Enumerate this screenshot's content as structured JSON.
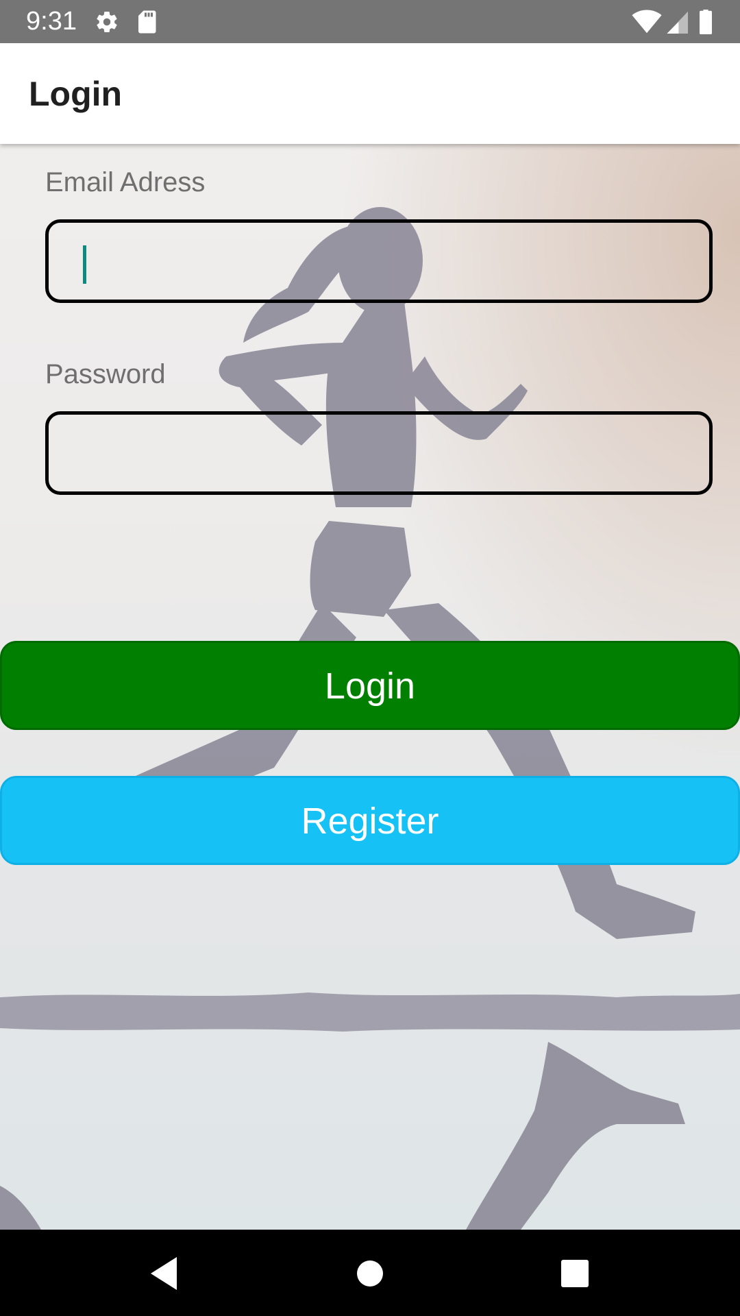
{
  "status_bar": {
    "time": "9:31",
    "left_icons": [
      "gear-icon",
      "sd-card-icon"
    ],
    "right_icons": [
      "wifi-icon",
      "signal-icon",
      "battery-icon"
    ]
  },
  "app_bar": {
    "title": "Login"
  },
  "form": {
    "email": {
      "label": "Email Adress",
      "value": ""
    },
    "password": {
      "label": "Password",
      "value": ""
    }
  },
  "buttons": {
    "login": {
      "label": "Login",
      "color": "#007f00"
    },
    "register": {
      "label": "Register",
      "color": "#16c1f5"
    }
  },
  "background": {
    "image": "runner-silhouette"
  },
  "nav_bar": {
    "icons": [
      "back-icon",
      "home-icon",
      "recents-icon"
    ]
  }
}
